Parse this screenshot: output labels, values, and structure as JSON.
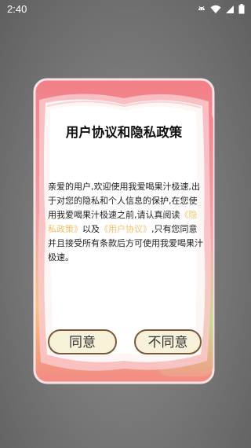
{
  "status_bar": {
    "time": "2:40",
    "icons": [
      "android-icon",
      "wifi-icon",
      "signal-icon",
      "battery-icon"
    ]
  },
  "dialog": {
    "title": "用户协议和隐私政策",
    "body_part1": "亲爱的用户,欢迎使用我爱喝果汁极速,出于对您的隐私和个人信息的保护,在您使用我爱喝果汁极速之前,请认真阅读",
    "privacy_link": "《隐私政策》",
    "body_part2": "以及",
    "agreement_link": "《用户协议》",
    "body_part3": ",只有您同意并且接受所有条款后方可使用我爱喝果汁极速。",
    "agree_label": "同意",
    "disagree_label": "不同意",
    "link_color": "#f2c26b"
  }
}
